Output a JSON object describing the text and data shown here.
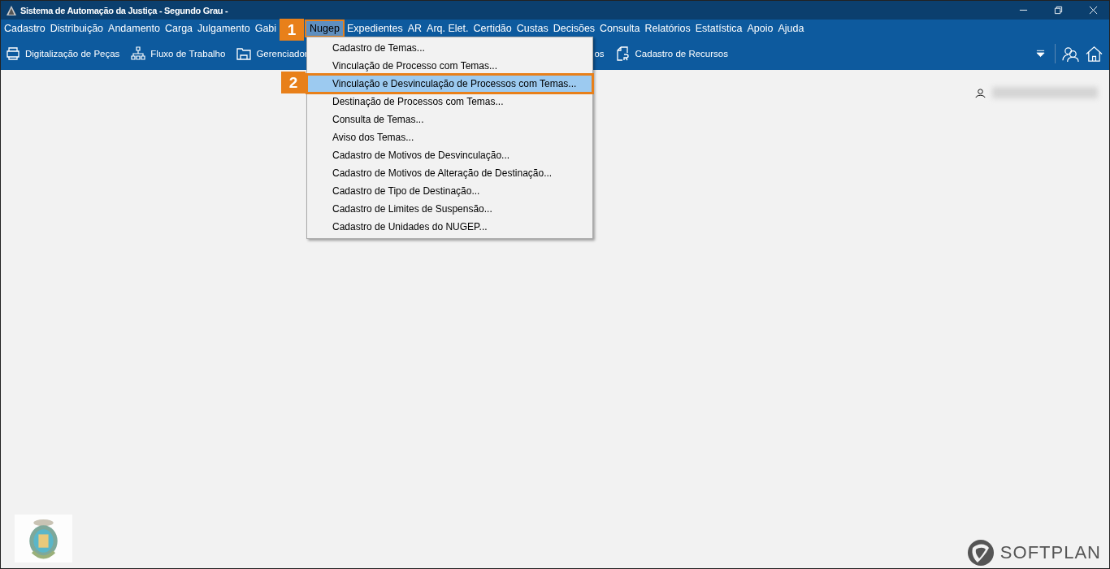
{
  "window": {
    "title": "Sistema de Automação da Justiça - Segundo Grau -"
  },
  "menu_bar": [
    {
      "label": "Cadastro",
      "selected": false
    },
    {
      "label": "Distribuição",
      "selected": false
    },
    {
      "label": "Andamento",
      "selected": false
    },
    {
      "label": "Carga",
      "selected": false
    },
    {
      "label": "Julgamento",
      "selected": false
    },
    {
      "label": "Gabi",
      "selected": false
    },
    {
      "label": "Nugep",
      "selected": true
    },
    {
      "label": "Expedientes",
      "selected": false
    },
    {
      "label": "AR",
      "selected": false
    },
    {
      "label": "Arq. Elet.",
      "selected": false
    },
    {
      "label": "Certidão",
      "selected": false
    },
    {
      "label": "Custas",
      "selected": false
    },
    {
      "label": "Decisões",
      "selected": false
    },
    {
      "label": "Consulta",
      "selected": false
    },
    {
      "label": "Relatórios",
      "selected": false
    },
    {
      "label": "Estatística",
      "selected": false
    },
    {
      "label": "Apoio",
      "selected": false
    },
    {
      "label": "Ajuda",
      "selected": false
    }
  ],
  "toolbar": [
    {
      "label": "Digitalização de Peças",
      "kind": "scanner"
    },
    {
      "label": "Fluxo de Trabalho",
      "kind": "hierarchy"
    },
    {
      "label": "Gerenciador",
      "kind": "folder"
    },
    {
      "label": "os",
      "kind": "text"
    },
    {
      "label": "Cadastro de Recursos",
      "kind": "document"
    }
  ],
  "dropdown_menu": {
    "items": [
      {
        "label": "Cadastro de Temas...",
        "selected": false
      },
      {
        "label": "Vinculação de Processo com Temas...",
        "selected": false
      },
      {
        "label": "Vinculação e Desvinculação de Processos com Temas...",
        "selected": true
      },
      {
        "label": "Destinação de Processos com Temas...",
        "selected": false
      },
      {
        "label": "Consulta de Temas...",
        "selected": false
      },
      {
        "label": "Aviso dos Temas...",
        "selected": false
      },
      {
        "label": "Cadastro de Motivos de Desvinculação...",
        "selected": false
      },
      {
        "label": "Cadastro de Motivos de Alteração de Destinação...",
        "selected": false
      },
      {
        "label": "Cadastro de Tipo de Destinação...",
        "selected": false
      },
      {
        "label": "Cadastro de Limites de Suspensão...",
        "selected": false
      },
      {
        "label": "Cadastro de Unidades do NUGEP...",
        "selected": false
      }
    ]
  },
  "callouts": [
    "1",
    "2"
  ],
  "footer_logo": {
    "text": "SOFTPLAN"
  }
}
